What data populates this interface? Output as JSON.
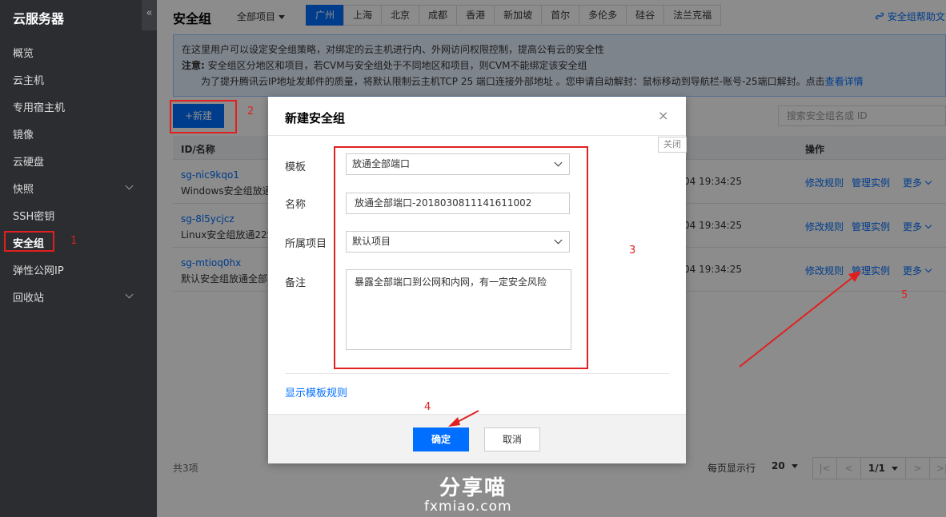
{
  "sidebar": {
    "title": "云服务器",
    "collapse_icon": "«",
    "items": [
      {
        "label": "概览"
      },
      {
        "label": "云主机"
      },
      {
        "label": "专用宿主机"
      },
      {
        "label": "镜像"
      },
      {
        "label": "云硬盘"
      },
      {
        "label": "快照"
      },
      {
        "label": "SSH密钥"
      },
      {
        "label": "安全组"
      },
      {
        "label": "弹性公网IP"
      },
      {
        "label": "回收站"
      }
    ]
  },
  "header": {
    "title": "安全组",
    "project_select": "全部项目",
    "regions": [
      "广州",
      "上海",
      "北京",
      "成都",
      "香港",
      "新加坡",
      "首尔",
      "多伦多",
      "硅谷",
      "法兰克福"
    ],
    "help_link": "安全组帮助文"
  },
  "notice": {
    "line1": "在这里用户可以设定安全组策略，对绑定的云主机进行内、外网访问权限控制，提高公有云的安全性",
    "note_label": "注意:",
    "line2": "安全组区分地区和项目，若CVM与安全组处于不同地区和项目，则CVM不能绑定该安全组",
    "line3": "为了提升腾讯云IP地址发邮件的质量，将默认限制云主机TCP 25 端口连接外部地址 。您申请自动解封：鼠标移动到导航栏-账号-25端口解封。点击",
    "line3_link": "查看详情"
  },
  "toolbar": {
    "new_button": "+新建",
    "search_placeholder": "搜索安全组名或 ID"
  },
  "table": {
    "headers": {
      "id_name": "ID/名称",
      "ops": "操作"
    },
    "rows": [
      {
        "id": "sg-nic9kqo1",
        "desc": "Windows安全组放通",
        "time": "04 19:34:25"
      },
      {
        "id": "sg-8l5ycjcz",
        "desc": "Linux安全组放通22端",
        "time": "04 19:34:25"
      },
      {
        "id": "sg-mtioq0hx",
        "desc": "默认安全组放通全部",
        "time": "04 19:34:25"
      }
    ],
    "op_edit": "修改规则",
    "op_manage": "管理实例",
    "op_more": "更多"
  },
  "footer": {
    "count": "共3项",
    "per_page_label": "每页显示行",
    "per_page_value": "20",
    "page": "1/1"
  },
  "modal": {
    "title": "新建安全组",
    "close_icon": "×",
    "close_tooltip": "关闭",
    "template_label": "模板",
    "template_value": "放通全部端口",
    "name_label": "名称",
    "name_value": "放通全部端口-2018030811141611002",
    "project_label": "所属项目",
    "project_value": "默认项目",
    "remark_label": "备注",
    "remark_value": "暴露全部端口到公网和内网，有一定安全风险",
    "show_rules": "显示模板规则",
    "ok": "确定",
    "cancel": "取消"
  },
  "annotations": [
    "1",
    "2",
    "3",
    "4",
    "5"
  ],
  "watermark": {
    "title": "分享喵",
    "sub": "fxmiao.com"
  },
  "colors": {
    "accent": "#006eff",
    "annotation": "#e02020",
    "sidebar_bg": "#2b2d31"
  }
}
